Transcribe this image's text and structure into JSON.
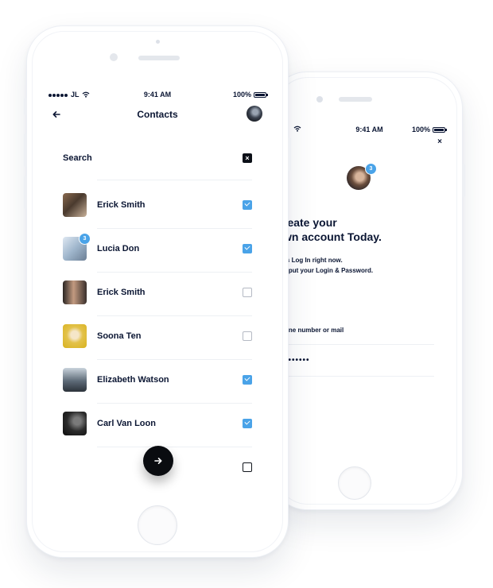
{
  "colors": {
    "accent": "#4aa3e8",
    "text": "#0b1633",
    "fab": "#0a0c10",
    "background": "#ffffff"
  },
  "front_phone": {
    "status_bar": {
      "carrier": "JL",
      "time": "9:41 AM",
      "battery": "100%"
    },
    "header": {
      "back_icon": "arrow-left-icon",
      "title": "Contacts"
    },
    "search": {
      "label": "Search",
      "clear_icon": "close-icon"
    },
    "contacts": [
      {
        "name": "Erick Smith",
        "checked": true
      },
      {
        "name": "Lucia Don",
        "checked": true,
        "badge": "3"
      },
      {
        "name": "Erick Smith",
        "checked": false
      },
      {
        "name": "Soona Ten",
        "checked": false
      },
      {
        "name": "Elizabeth Watson",
        "checked": true
      },
      {
        "name": "Carl Van Loon",
        "checked": true
      }
    ],
    "next_button_icon": "arrow-right-icon"
  },
  "back_phone": {
    "status_bar": {
      "time": "9:41 AM",
      "battery": "100%"
    },
    "close_label": "×",
    "avatar_badge": "3",
    "heading_line1": "reate your",
    "heading_line2": "wn account Today.",
    "sub_line1": "'s Log In right now.",
    "sub_line2": "t put your Login & Password.",
    "field_label": "one number or mail",
    "password_mask": "•••••••"
  }
}
